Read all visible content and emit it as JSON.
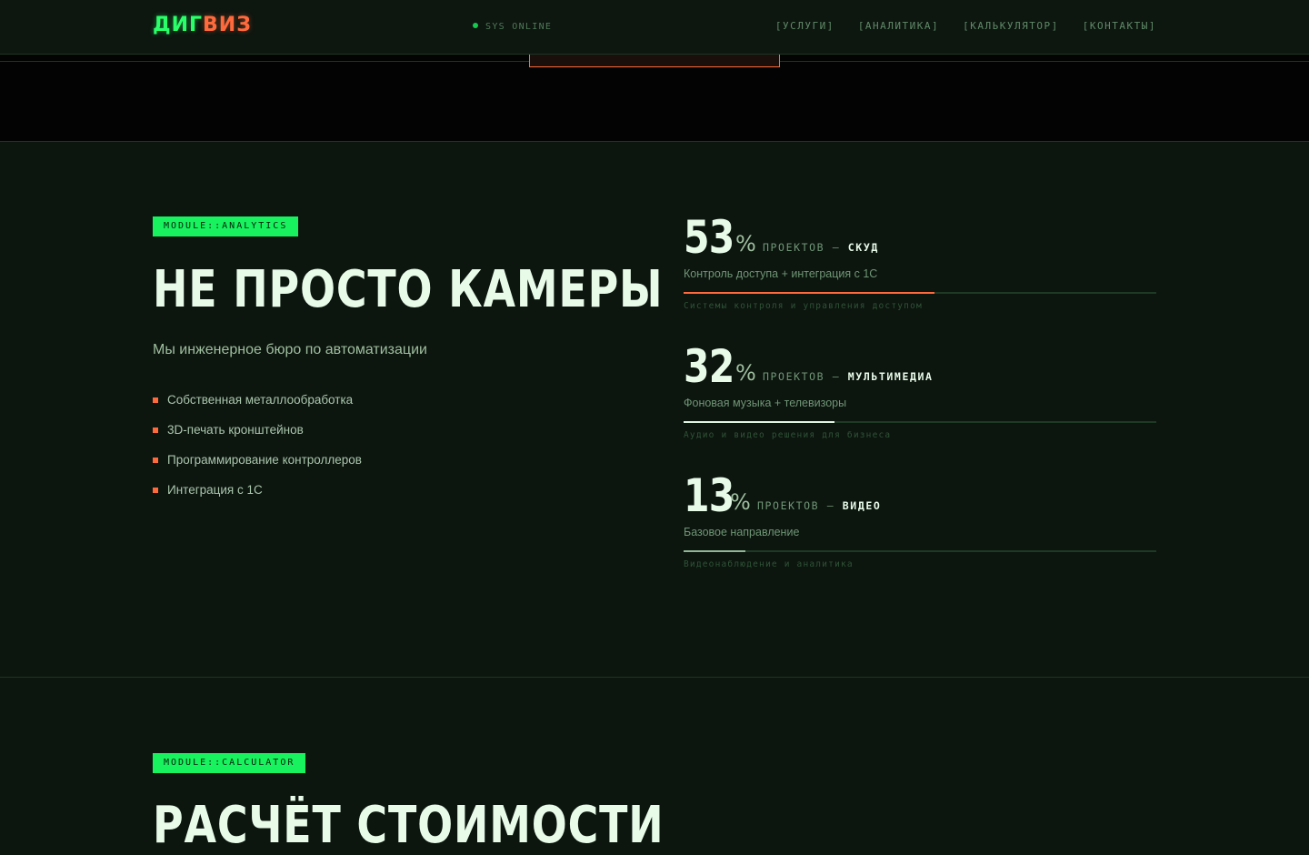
{
  "header": {
    "logo_part1": "ДИГ",
    "logo_part2": "ВИЗ",
    "status": "SYS ONLINE",
    "nav": [
      "[УСЛУГИ]",
      "[АНАЛИТИКА]",
      "[КАЛЬКУЛЯТОР]",
      "[КОНТАКТЫ]"
    ]
  },
  "analytics": {
    "tag": "MODULE::ANALYTICS",
    "title": "НЕ ПРОСТО КАМЕРЫ",
    "subtitle": "Мы инженерное бюро по автоматизации",
    "features": [
      "Собственная металлообработка",
      "3D-печать кронштейнов",
      "Программирование контроллеров",
      "Интеграция с 1С"
    ],
    "stats": [
      {
        "value": "53",
        "unit": "%",
        "label_prefix": "ПРОЕКТОВ —",
        "label_strong": "СКУД",
        "description": "Контроль доступа + интеграция с 1С",
        "note": "Системы контроля и управления доступом",
        "fraction": 0.53,
        "color": "#ff6a3d"
      },
      {
        "value": "32",
        "unit": "%",
        "label_prefix": "ПРОЕКТОВ —",
        "label_strong": "МУЛЬТИМЕДИА",
        "description": "Фоновая музыка + телевизоры",
        "note": "Аудио и видео решения для бизнеса",
        "fraction": 0.32,
        "color": "#dff5e2"
      },
      {
        "value": "13",
        "unit": "%",
        "label_prefix": "ПРОЕКТОВ —",
        "label_strong": "ВИДЕО",
        "description": "Базовое направление",
        "note": "Видеонаблюдение и аналитика",
        "fraction": 0.13,
        "color": "#8fb696"
      }
    ]
  },
  "calculator": {
    "tag": "MODULE::CALCULATOR",
    "title": "РАСЧЁТ СТОИМОСТИ"
  },
  "colors": {
    "accent_green": "#18f25e",
    "accent_orange": "#ff6a3d",
    "background": "#0c150e"
  }
}
